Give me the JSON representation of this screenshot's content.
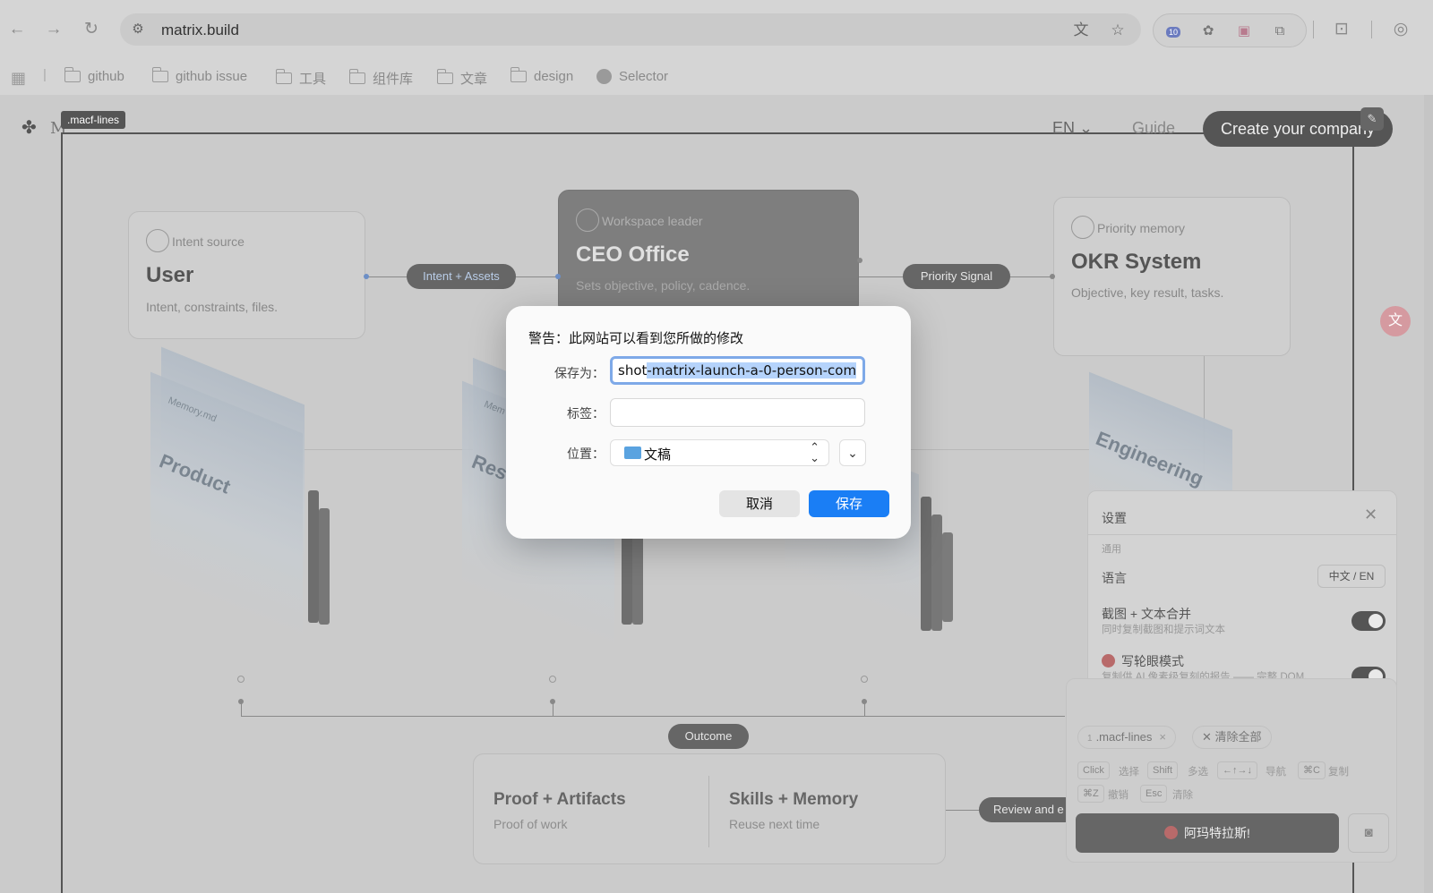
{
  "browser": {
    "url": "matrix.build",
    "ext_badge": "10",
    "bookmarks": [
      {
        "label": "github"
      },
      {
        "label": "github issue"
      },
      {
        "label": "工具"
      },
      {
        "label": "组件库"
      },
      {
        "label": "文章"
      },
      {
        "label": "design"
      },
      {
        "label": "Selector"
      }
    ]
  },
  "page": {
    "tag_label": ".macf-lines",
    "logo_text": "M",
    "lang": "EN",
    "guide": "Guide",
    "create_btn": "Create your company",
    "cards": {
      "user": {
        "kicker": "Intent source",
        "title": "User",
        "sub": "Intent, constraints, files."
      },
      "ceo": {
        "kicker": "Workspace leader",
        "title": "CEO Office",
        "sub": "Sets objective, policy, cadence."
      },
      "okr": {
        "kicker": "Priority memory",
        "title": "OKR System",
        "sub": "Objective, key result, tasks."
      }
    },
    "pills": {
      "intent": "Intent + Assets",
      "priority": "Priority Signal",
      "outcome": "Outcome",
      "review": "Review and e"
    },
    "folders": {
      "product": "Product",
      "product_file": "Memory.md",
      "research": "Rese",
      "research_file": "Mem",
      "engineering": "Engineering"
    },
    "bottom": {
      "left_title": "Proof + Artifacts",
      "left_sub": "Proof of work",
      "right_title": "Skills + Memory",
      "right_sub": "Reuse next time"
    }
  },
  "settings": {
    "title": "设置",
    "section": "通用",
    "language_label": "语言",
    "language_value": "中文 / EN",
    "merge_label": "截图 + 文本合并",
    "merge_desc": "同时复制截图和提示词文本",
    "merge_on": true,
    "wheel_label": "写轮眼模式",
    "wheel_desc": "复制供 AI 像素级复刻的报告 —— 完整 DOM、hover/dark 样式、字体、动画与设计 token",
    "wheel_on": true
  },
  "tray": {
    "selected_chip": ".macf-lines",
    "selected_index": "1",
    "clear_all": "清除全部",
    "shortcuts": [
      {
        "key": "Click",
        "desc": "选择"
      },
      {
        "key": "Shift",
        "desc": "多选"
      },
      {
        "key": "←↑→↓",
        "desc": "导航"
      },
      {
        "key": "⌘C",
        "desc": "复制"
      },
      {
        "key": "⌘Z",
        "desc": "撤销"
      },
      {
        "key": "Esc",
        "desc": "清除"
      }
    ],
    "action_btn": "阿玛特拉斯!"
  },
  "dialog": {
    "title": "警告：此网站可以看到您所做的修改",
    "save_as_label": "保存为：",
    "save_as_prefix": "shot",
    "save_as_selected": "-matrix-launch-a-0-person-com",
    "tags_label": "标签：",
    "tags_value": "",
    "location_label": "位置：",
    "location_value": "文稿",
    "cancel": "取消",
    "save": "保存"
  },
  "colors": {
    "accent": "#1a7ef5",
    "selection": "#b5d3fb",
    "focus_ring": "#7ea9e8"
  }
}
